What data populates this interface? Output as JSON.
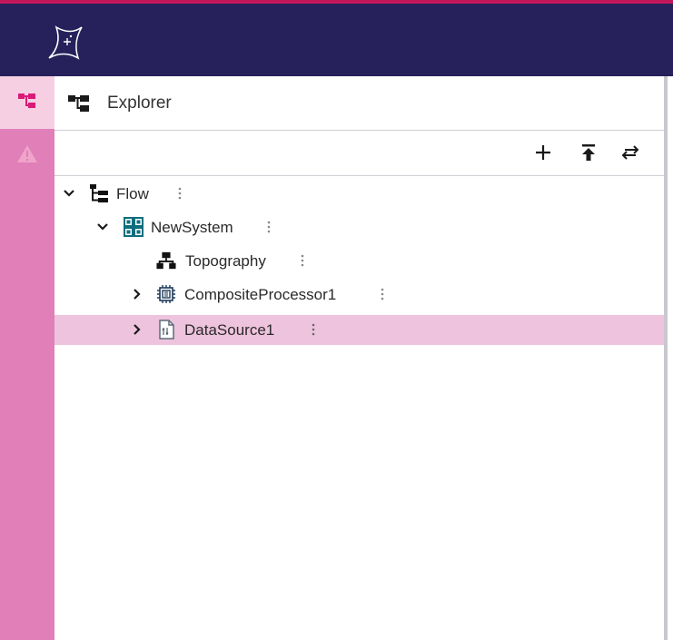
{
  "colors": {
    "accent": "#c2185b",
    "header_bg": "#26215a",
    "rail_bg": "#e07fb8",
    "rail_active": "#f6cfe3",
    "selected_row": "#eec3dd",
    "icon_teal": "#0f6e7d"
  },
  "rail": {
    "items": [
      {
        "name": "explorer",
        "icon": "tree-icon",
        "active": true
      },
      {
        "name": "warnings",
        "icon": "warning-icon",
        "active": false
      }
    ]
  },
  "explorer": {
    "title": "Explorer",
    "toolbar": {
      "add_icon": "plus-icon",
      "collapse_icon": "collapse-all-icon",
      "swap_icon": "swap-icon"
    },
    "tree": [
      {
        "label": "Flow",
        "icon": "flow-tree-icon",
        "expanded": true,
        "depth": 0
      },
      {
        "label": "NewSystem",
        "icon": "system-grid-icon",
        "expanded": true,
        "depth": 1
      },
      {
        "label": "Topography",
        "icon": "topography-icon",
        "expanded": null,
        "depth": 2
      },
      {
        "label": "CompositeProcessor1",
        "icon": "processor-chip-icon",
        "expanded": false,
        "depth": 2
      },
      {
        "label": "DataSource1",
        "icon": "data-source-icon",
        "expanded": false,
        "depth": 2,
        "selected": true
      }
    ]
  }
}
